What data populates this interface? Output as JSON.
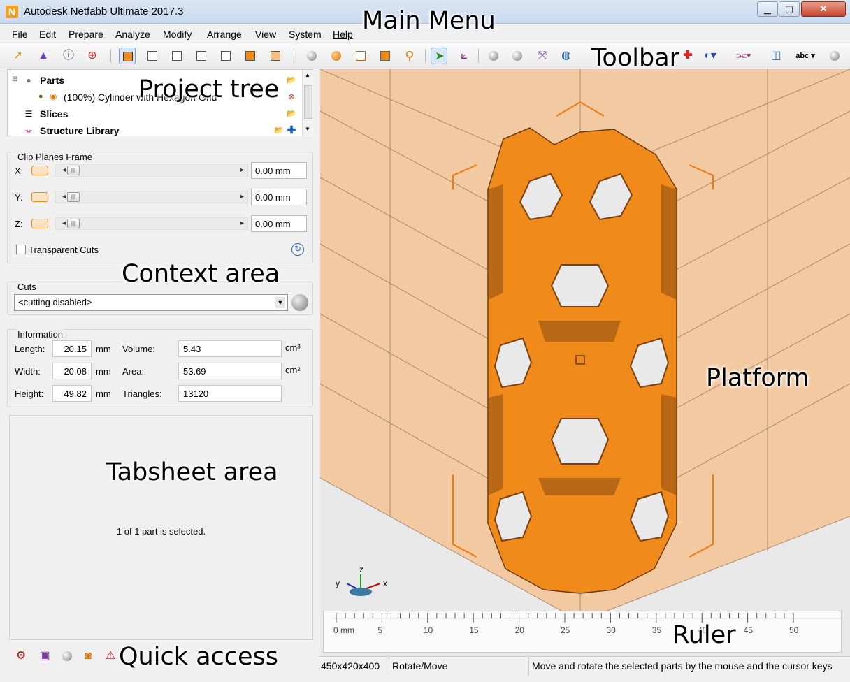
{
  "window": {
    "title": "Autodesk Netfabb Ultimate 2017.3",
    "logo_letter": "N"
  },
  "menu": [
    "File",
    "Edit",
    "Prepare",
    "Analyze",
    "Modify",
    "Arrange",
    "View",
    "System",
    "Help"
  ],
  "annotations": {
    "main_menu": "Main Menu",
    "toolbar": "Toolbar",
    "project_tree": "Project tree",
    "context_area": "Context area",
    "platform": "Platform",
    "tabsheet_area": "Tabsheet area",
    "ruler": "Ruler",
    "quick_access": "Quick access"
  },
  "tree": {
    "parts_label": "Parts",
    "part_item": "(100%) Cylinder with Hexagon Grid",
    "slices_label": "Slices",
    "structure_label": "Structure Library"
  },
  "clip_planes": {
    "title": "Clip Planes Frame",
    "axes": [
      {
        "label": "X:",
        "value": "0.00 mm"
      },
      {
        "label": "Y:",
        "value": "0.00 mm"
      },
      {
        "label": "Z:",
        "value": "0.00 mm"
      }
    ],
    "transparent_label": "Transparent Cuts"
  },
  "cuts": {
    "title": "Cuts",
    "selected": "<cutting disabled>"
  },
  "information": {
    "title": "Information",
    "length_label": "Length:",
    "length": "20.15",
    "width_label": "Width:",
    "width": "20.08",
    "height_label": "Height:",
    "height": "49.82",
    "unit_mm": "mm",
    "volume_label": "Volume:",
    "volume": "5.43",
    "volume_unit": "cm³",
    "area_label": "Area:",
    "area": "53.69",
    "area_unit": "cm²",
    "triangles_label": "Triangles:",
    "triangles": "13120"
  },
  "tabsheet": {
    "selection_text": "1 of 1 part is selected."
  },
  "ruler": {
    "ticks": [
      "0 mm",
      "5",
      "10",
      "15",
      "20",
      "25",
      "30",
      "35",
      "40",
      "45",
      "50"
    ]
  },
  "axes_triad": {
    "x": "x",
    "y": "y",
    "z": "z"
  },
  "status": {
    "platform_size": "450x420x400",
    "mode": "Rotate/Move",
    "hint": "Move and rotate the selected parts by the mouse and the cursor keys"
  },
  "colors": {
    "part_orange": "#f08a1a",
    "platform": "#f2c9a0",
    "accent": "#f07a10"
  }
}
